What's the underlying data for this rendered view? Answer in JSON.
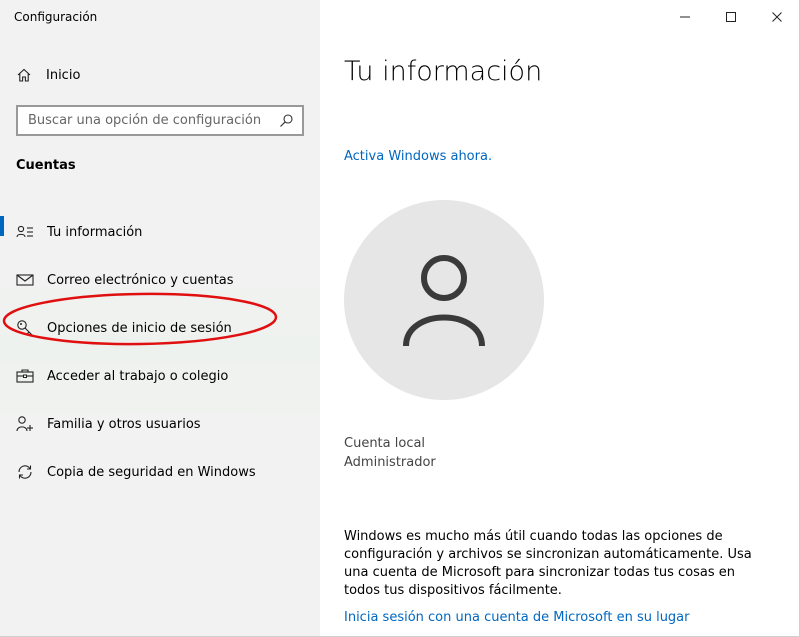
{
  "window": {
    "title": "Configuración",
    "controls": {
      "minimize_icon": "minimize-icon",
      "maximize_icon": "maximize-icon",
      "close_icon": "close-icon"
    }
  },
  "sidebar": {
    "home_label": "Inicio",
    "search": {
      "placeholder": "Buscar una opción de configuración",
      "value": ""
    },
    "section_title": "Cuentas",
    "items": [
      {
        "label": "Tu información",
        "icon": "person-card-icon",
        "active": true
      },
      {
        "label": "Correo electrónico y cuentas",
        "icon": "mail-icon",
        "active": false
      },
      {
        "label": "Opciones de inicio de sesión",
        "icon": "key-icon",
        "active": false
      },
      {
        "label": "Acceder al trabajo o colegio",
        "icon": "briefcase-icon",
        "active": false
      },
      {
        "label": "Familia y otros usuarios",
        "icon": "person-add-icon",
        "active": false
      },
      {
        "label": "Copia de seguridad en Windows",
        "icon": "sync-icon",
        "active": false
      }
    ]
  },
  "main": {
    "title": "Tu información",
    "activate_link": "Activa Windows ahora.",
    "account_type": "Cuenta local",
    "account_role": "Administrador",
    "info_text": "Windows es mucho más útil cuando todas las opciones de configuración y archivos se sincronizan automáticamente. Usa una cuenta de Microsoft para sincronizar todas tus cosas en todos tus dispositivos fácilmente.",
    "signin_link": "Inicia sesión con una cuenta de Microsoft en su lugar"
  },
  "colors": {
    "accent": "#0067c0",
    "highlight": "#e01010",
    "sidebar_bg": "#f2f2f2",
    "avatar_bg": "#e6e6e6"
  }
}
